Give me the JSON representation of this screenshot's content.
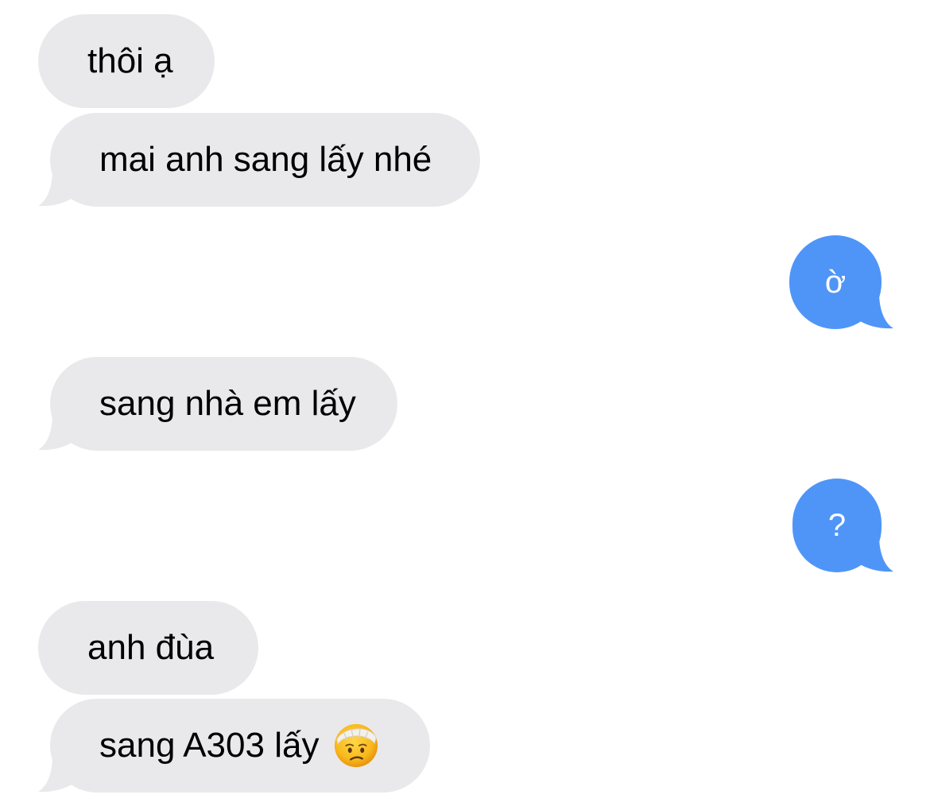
{
  "conversation": {
    "messages": [
      {
        "direction": "incoming",
        "text": "thôi ạ"
      },
      {
        "direction": "incoming",
        "text": "mai anh sang lấy nhé"
      },
      {
        "direction": "outgoing",
        "text": "ờ"
      },
      {
        "direction": "incoming",
        "text": "sang nhà em lấy"
      },
      {
        "direction": "outgoing",
        "text": "?"
      },
      {
        "direction": "incoming",
        "text": "anh đùa"
      },
      {
        "direction": "incoming",
        "text": "sang A303 lấy",
        "emoji": "face-with-head-bandage-emoji"
      }
    ]
  },
  "colors": {
    "incoming_bubble": "#e9e9eb",
    "outgoing_bubble": "#4f95f8",
    "incoming_text": "#000000",
    "outgoing_text": "#ffffff",
    "background": "#ffffff"
  }
}
